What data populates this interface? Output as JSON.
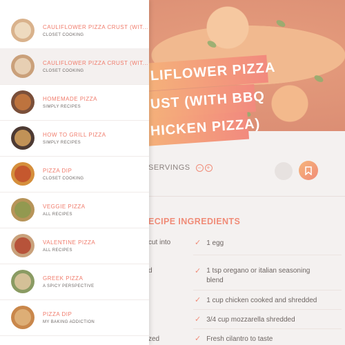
{
  "recipe": {
    "title_lines": [
      "LIFLOWER PIZZA",
      "UST (WITH BBQ",
      "HICKEN PIZZA)"
    ],
    "servings_label": "SERVINGS",
    "minus_label": "−",
    "plus_label": "+",
    "ingredients_title": "ECIPE INGREDIENTS",
    "ingredients_right": [
      "1 egg",
      "1 tsp oregano or italian seasoning blend",
      "1 cup chicken cooked and shredded",
      "3/4 cup mozzarella shredded",
      "Fresh cilantro to taste"
    ],
    "ingredients_left_fragments": [
      "cut into",
      "d",
      "zed"
    ],
    "check_icon": "check-icon",
    "save_icon": "bookmark-icon"
  },
  "drawer": {
    "items": [
      {
        "title": "CAULIFLOWER PIZZA CRUST (WIT...",
        "source": "CLOSET COOKING",
        "active": false,
        "thumb_base": "#d9b28c",
        "thumb_top": "#f1e0c8"
      },
      {
        "title": "CAULIFLOWER PIZZA CRUST (WIT...",
        "source": "CLOSET COOKING",
        "active": true,
        "thumb_base": "#caa07a",
        "thumb_top": "#ecd7bd"
      },
      {
        "title": "HOMEMADE PIZZA",
        "source": "SIMPLY RECIPES",
        "active": false,
        "thumb_base": "#7a4f3a",
        "thumb_top": "#c9793f"
      },
      {
        "title": "HOW TO GRILL PIZZA",
        "source": "SIMPLY RECIPES",
        "active": false,
        "thumb_base": "#4d3a33",
        "thumb_top": "#d6a25e"
      },
      {
        "title": "PIZZA DIP",
        "source": "CLOSET COOKING",
        "active": false,
        "thumb_base": "#d58f3c",
        "thumb_top": "#c24f2c"
      },
      {
        "title": "VEGGIE PIZZA",
        "source": "ALL RECIPES",
        "active": false,
        "thumb_base": "#b79459",
        "thumb_top": "#8c9a4f"
      },
      {
        "title": "VALENTINE PIZZA",
        "source": "ALL RECIPES",
        "active": false,
        "thumb_base": "#c9a27c",
        "thumb_top": "#b4452f"
      },
      {
        "title": "GREEK PIZZA",
        "source": "A SPICY PERSPECTIVE",
        "active": false,
        "thumb_base": "#8a9b63",
        "thumb_top": "#e0c7a0"
      },
      {
        "title": "PIZZA DIP",
        "source": "MY BAKING ADDICTION",
        "active": false,
        "thumb_base": "#c9874b",
        "thumb_top": "#e1b57e"
      }
    ]
  },
  "colors": {
    "accent": "#f07b6b",
    "accent_gradient_start": "#f6b67a",
    "muted_text": "#6e6866"
  }
}
